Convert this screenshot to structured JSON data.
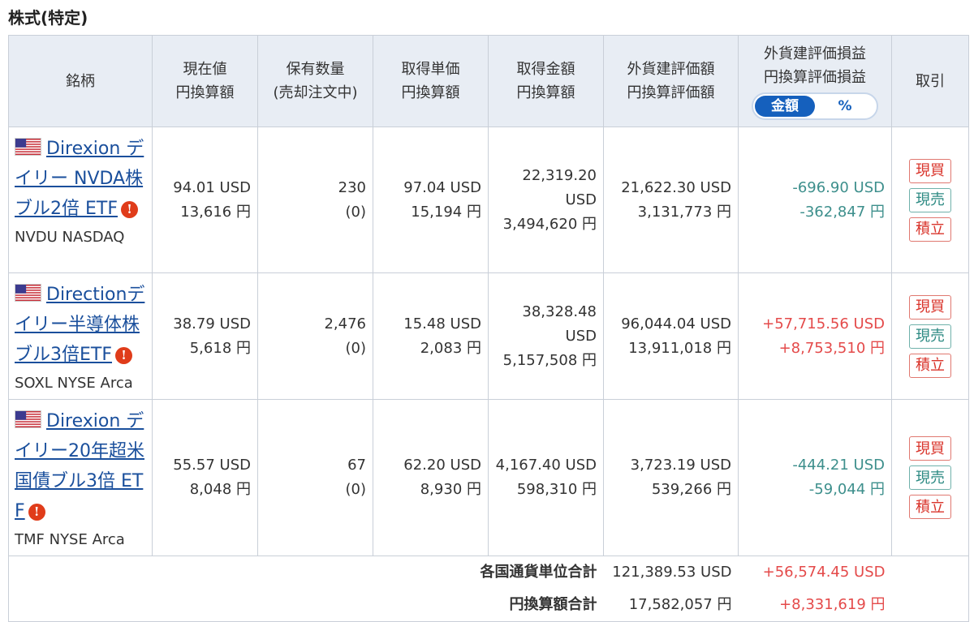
{
  "section_title": "株式(特定)",
  "headers": {
    "name": "銘柄",
    "price": [
      "現在値",
      "円換算額"
    ],
    "qty": [
      "保有数量",
      "(売却注文中)"
    ],
    "unit_cost": [
      "取得単価",
      "円換算額"
    ],
    "cost_amount": [
      "取得金額",
      "円換算額"
    ],
    "valuation": [
      "外貨建評価額",
      "円換算評価額"
    ],
    "pnl": [
      "外貨建評価損益",
      "円換算評価損益"
    ],
    "trade": "取引"
  },
  "toggle": {
    "amount": "金額",
    "percent": "%",
    "selected": "amount"
  },
  "rows": [
    {
      "name_lines": [
        "Direxion デ",
        "イリー NVDA株",
        "ブル2倍 ETF"
      ],
      "ticker": "NVDU NASDAQ",
      "price_usd": "94.01 USD",
      "price_jpy": "13,616 円",
      "qty": "230",
      "qty_selling": "(0)",
      "unit_usd": "97.04 USD",
      "unit_jpy": "15,194 円",
      "cost_usd_1": "22,319.20",
      "cost_usd_2": "USD",
      "cost_jpy": "3,494,620 円",
      "val_usd": "21,622.30 USD",
      "val_jpy": "3,131,773 円",
      "pnl_usd": "-696.90 USD",
      "pnl_jpy": "-362,847 円",
      "pnl_sign": "neg"
    },
    {
      "name_lines": [
        "Directionデ",
        "イリー半導体株",
        "ブル3倍ETF"
      ],
      "ticker": "SOXL NYSE Arca",
      "price_usd": "38.79 USD",
      "price_jpy": "5,618 円",
      "qty": "2,476",
      "qty_selling": "(0)",
      "unit_usd": "15.48 USD",
      "unit_jpy": "2,083 円",
      "cost_usd_1": "38,328.48",
      "cost_usd_2": "USD",
      "cost_jpy": "5,157,508 円",
      "val_usd": "96,044.04 USD",
      "val_jpy": "13,911,018 円",
      "pnl_usd": "+57,715.56 USD",
      "pnl_jpy": "+8,753,510 円",
      "pnl_sign": "pos"
    },
    {
      "name_lines": [
        "Direxion デ",
        "イリー20年超米",
        "国債ブル3倍 ET",
        "F"
      ],
      "ticker": "TMF NYSE Arca",
      "price_usd": "55.57 USD",
      "price_jpy": "8,048 円",
      "qty": "67",
      "qty_selling": "(0)",
      "unit_usd": "62.20 USD",
      "unit_jpy": "8,930 円",
      "cost_usd_1": "4,167.40 USD",
      "cost_usd_2": "",
      "cost_jpy": "598,310 円",
      "val_usd": "3,723.19 USD",
      "val_jpy": "539,266 円",
      "pnl_usd": "-444.21 USD",
      "pnl_jpy": "-59,044 円",
      "pnl_sign": "neg"
    }
  ],
  "trade_buttons": {
    "buy": "現買",
    "sell": "現売",
    "accumulate": "積立"
  },
  "totals": {
    "currency_label": "各国通貨単位合計",
    "currency_val": "121,389.53 USD",
    "currency_pnl": "+56,574.45 USD",
    "jpy_label": "円換算額合計",
    "jpy_val": "17,582,057 円",
    "jpy_pnl": "+8,331,619 円"
  },
  "colors": {
    "header_bg": "#e8edf4",
    "link": "#1a4f9c",
    "negative": "#3d8f8c",
    "positive": "#e44a4a",
    "toggle_active": "#1560bd",
    "info_icon": "#e03c1a"
  }
}
